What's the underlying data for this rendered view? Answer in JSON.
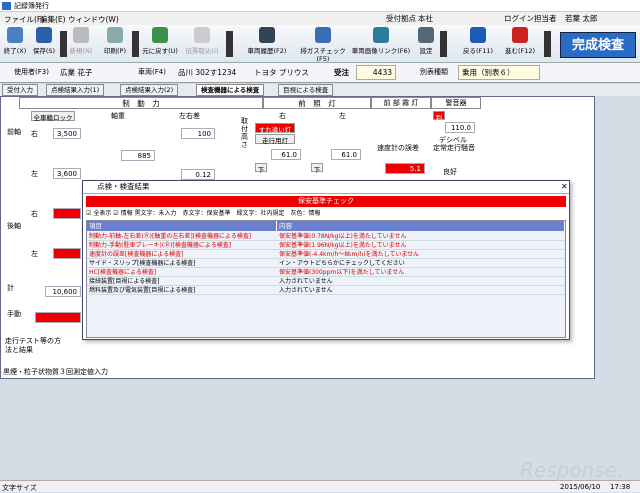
{
  "window": {
    "title": "記録簿発行"
  },
  "menu": {
    "items": [
      "ファイル(F)",
      "編集(E)",
      "ウィンドウ(W)"
    ]
  },
  "header": {
    "site_label": "受付拠点",
    "site_value": "本社",
    "user_label": "ログイン担当者",
    "user_value": "若葉 太郎"
  },
  "toolbar": {
    "buttons": [
      "終了(X)",
      "保存(S)",
      "新規(N)",
      "印刷(P)",
      "元に戻す(U)",
      "伝票取込(I)",
      "車両履歴(F2)",
      "排ガスチェック(F5)",
      "車両画像リンク(F6)",
      "設定"
    ],
    "back": "戻る(F11)",
    "next": "進む(F12)",
    "complete": "完成検査"
  },
  "info": {
    "owner_label": "使用者(F3)",
    "owner": "広業 花子",
    "vehicle_label": "車両(F4)",
    "plate": "品川 302す1234",
    "model": "トヨタ プリウス",
    "reception_label": "受注",
    "reception_no": "4433",
    "table_label": "別表種類",
    "table_value": "乗用（別表６）"
  },
  "tabs": [
    "受付入力",
    "点検結果入力(1)",
    "点検結果入力(2)",
    "検査機器による検査",
    "目視による検査"
  ],
  "grid": {
    "brake": "制　動　力",
    "lights": "前　照　灯",
    "fog": "前 部 霧 灯",
    "horn": "警音器",
    "front_axle": "前軸",
    "rear_axle": "後軸",
    "total": "計",
    "hand": "手動",
    "right": "右",
    "left": "左",
    "all_wheel_lock": "全車輪ロック",
    "axle_weight": "軸重",
    "lr_diff": "左右差",
    "fr_right": "3,500",
    "fr_left": "3,600",
    "weight_front": "885",
    "diff_front": "100",
    "diff_small": "0.12",
    "total_val": "10,600",
    "mount_height": "取付高さ",
    "pass_label": "すれ違い灯",
    "run_label": "走行用灯",
    "light_r": "61.0",
    "light_l": "61.0",
    "speed_err": "速度計の誤差",
    "speed_val": "5.1",
    "const_speed": "定常走行騒音",
    "db_val": "110.0",
    "decibel": "デシベル",
    "good": "良好",
    "judge": "判定",
    "test_run": "走行テスト等の方法と結果",
    "exhaust": "黒煙・粒子状物質３回測定値入力",
    "down": "下"
  },
  "dialog": {
    "title": "点検・検査結果",
    "alert": "保安基準チェック",
    "legend_all": "全表示",
    "legend_info": "情報",
    "legend_text": "黒文字：未入力　赤文字：保安基準　緑文字：社内規定　灰色：情報",
    "col_item": "項目",
    "col_content": "内容",
    "rows": [
      {
        "item": "制動力-前軸-左右差(Ⓡ)[軸重の左右差][検査機器による検査]",
        "content": "保安基準値(0.78N/kg以上)を満たしていません",
        "color": "#d00"
      },
      {
        "item": "制動力-手動(駐車ブレーキ)(Ⓡ)[検査機器による検査]",
        "content": "保安基準値(1.96N/kg以上)を満たしていません",
        "color": "#d00"
      },
      {
        "item": "速度計の誤差[検査機器による検査]",
        "content": "保安基準値(-4.4km/h〜8km/h)を満たしていません",
        "color": "#d00"
      },
      {
        "item": "サイド・スリップ[検査機器による検査]",
        "content": "イン・アウトどちらかにチェックしてください",
        "color": "#000"
      },
      {
        "item": "HC[検査機器による検査]",
        "content": "保安基準値(300ppm以下)を満たしていません",
        "color": "#d00"
      },
      {
        "item": "接続装置[目視による検査]",
        "content": "入力されていません",
        "color": "#000"
      },
      {
        "item": "燃料装置及び電気装置[目視による検査]",
        "content": "入力されていません",
        "color": "#000"
      }
    ]
  },
  "status": {
    "font_size": "文字サイズ",
    "date": "2015/06/10",
    "time": "17:38",
    "watermark": "Response."
  }
}
